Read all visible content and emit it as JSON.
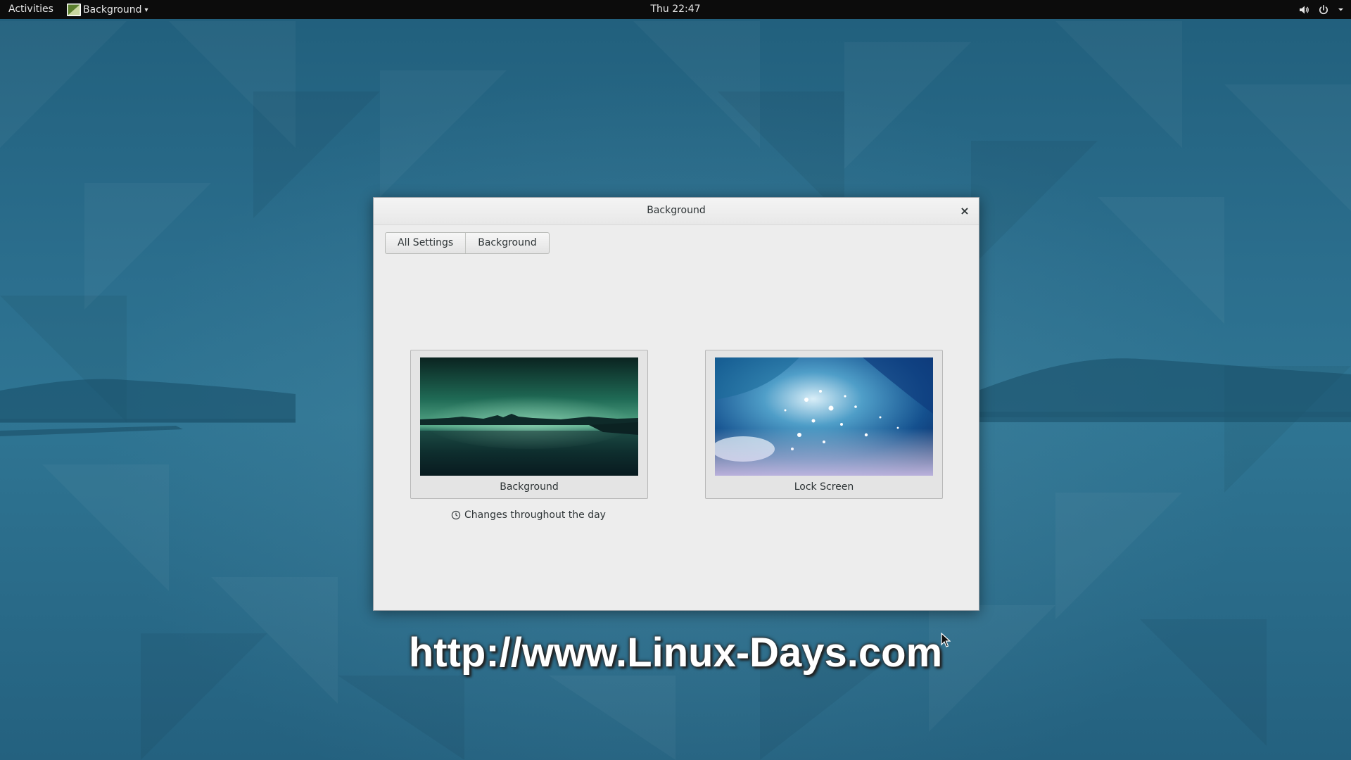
{
  "topbar": {
    "activities_label": "Activities",
    "app_menu_label": "Background",
    "clock": "Thu 22:47",
    "status_icons": [
      "volume-icon",
      "power-icon",
      "chevron-down-icon"
    ]
  },
  "window": {
    "title": "Background",
    "close_glyph": "×",
    "breadcrumb": [
      {
        "label": "All Settings"
      },
      {
        "label": "Background"
      }
    ],
    "cards": [
      {
        "label": "Background",
        "thumb": "lake-skyline-teal"
      },
      {
        "label": "Lock Screen",
        "thumb": "blue-bokeh-water"
      }
    ],
    "changes_label": "Changes throughout the day"
  },
  "watermark": "http://www.Linux-Days.com",
  "colors": {
    "topbar_bg": "#0c0c0c",
    "desktop_bg": "#2b6e8d",
    "window_bg": "#ededed"
  }
}
